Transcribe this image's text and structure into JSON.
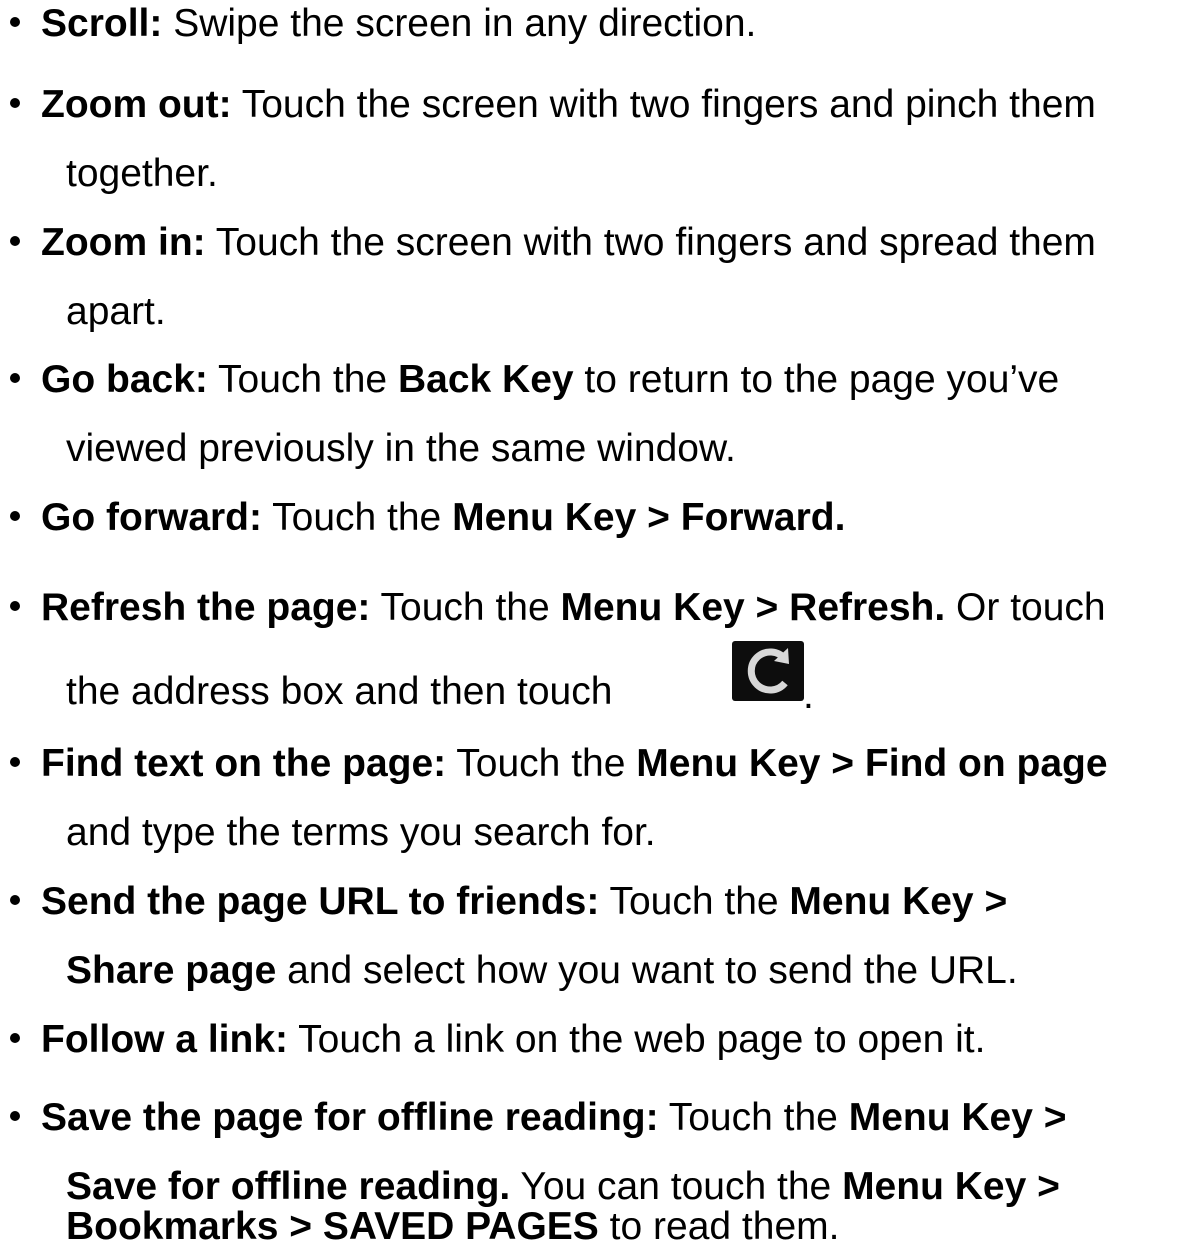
{
  "items": [
    {
      "b": "Scroll:",
      "t": " Swipe the screen in any direction."
    },
    {
      "b": "Zoom out:",
      "t": " Touch the screen with two fingers and pinch them",
      "t2": "together."
    },
    {
      "b": "Zoom in:",
      "t": " Touch the screen with two fingers and spread them",
      "t2": "apart."
    },
    {
      "b": "Go back:",
      "t": " Touch the ",
      "k": "Back Key",
      "t3": " to return to the page you’ve",
      "t2": "viewed previously in the same window."
    },
    {
      "b": "Go forward:",
      "t": " Touch the ",
      "k": "Menu Key > Forward."
    },
    {
      "b": "Refresh the page:",
      "t": " Touch the ",
      "k": "Menu Key > Refresh.",
      "t3": " Or touch",
      "t2": "the address box and then touch",
      "t2b": "."
    },
    {
      "b": "Find text on the page:",
      "t": " Touch the ",
      "k": "Menu Key > Find on page",
      "t2": "and type the terms you search for."
    },
    {
      "b": "Send the page URL to friends:",
      "t": " Touch the ",
      "k": "Menu Key >",
      "k2": "Share page",
      "t2": " and select how you want to send the URL."
    },
    {
      "b": "Follow a link:",
      "t": " Touch a link on the web page to open it."
    },
    {
      "b": "Save the page for offline reading:",
      "t": " Touch the ",
      "k": "Menu Key >",
      "k2": "Save for offline reading.",
      "t2": " You can touch the ",
      "k3": "Menu Key >",
      "k4": "Bookmarks > SAVED PAGES",
      "t4": " to read them."
    }
  ],
  "icons": {
    "refresh": "refresh-icon"
  }
}
